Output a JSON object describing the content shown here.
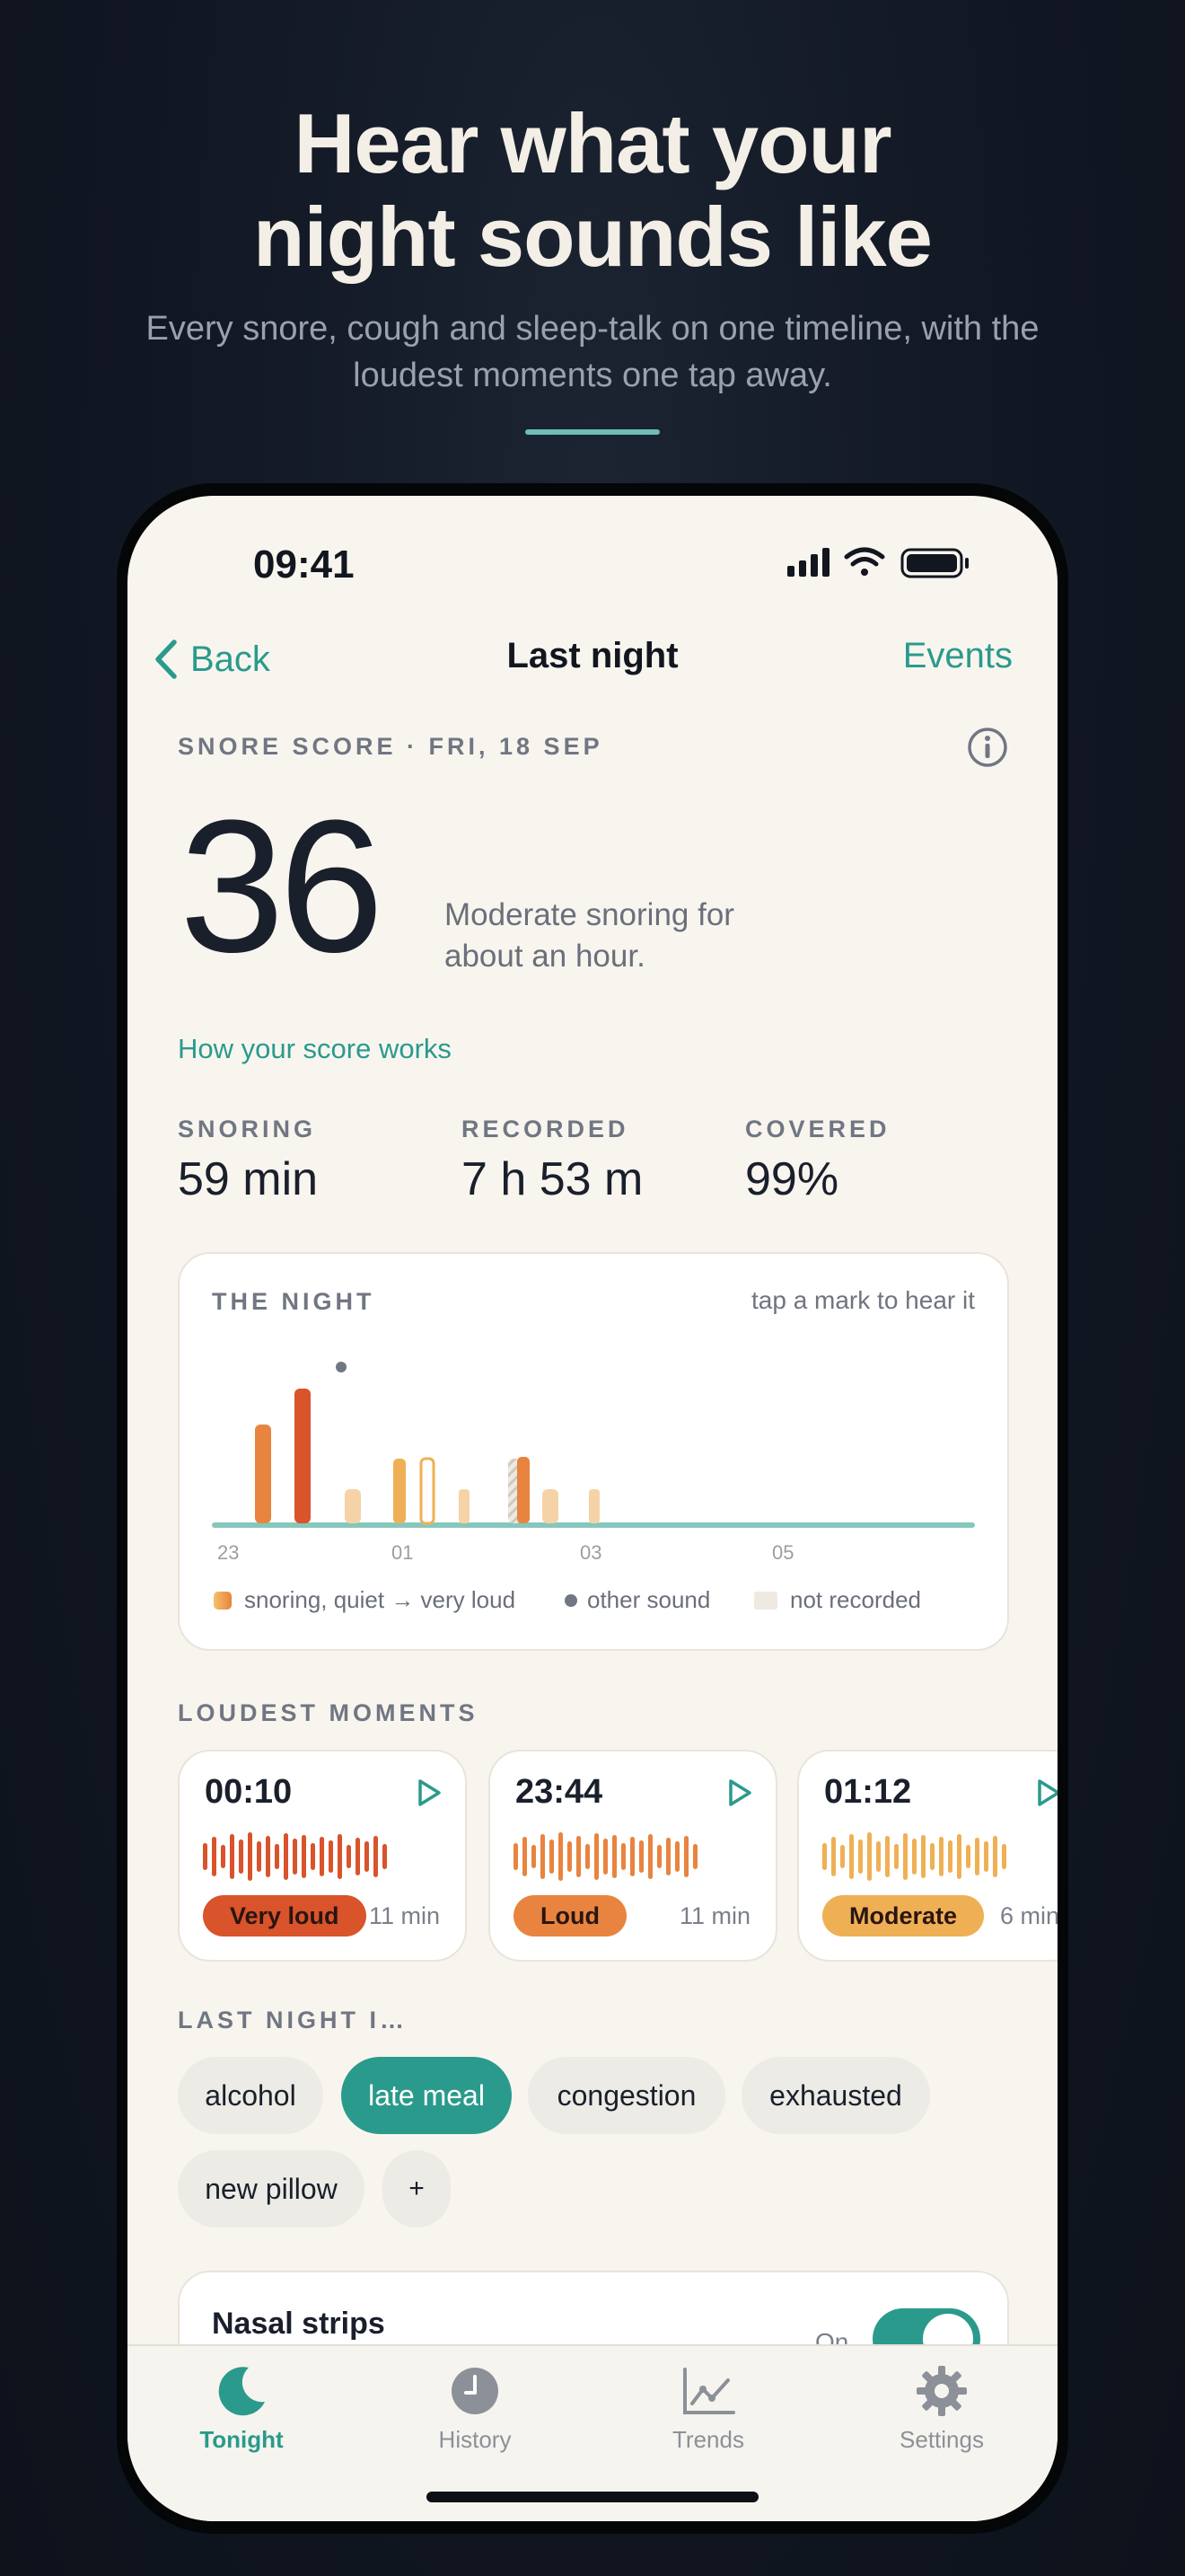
{
  "promo": {
    "title_line1": "Hear what your",
    "title_line2": "night sounds like",
    "subtitle": "Every snore, cough and sleep-talk on one timeline, with the loudest moments one tap away."
  },
  "status_bar": {
    "time": "09:41"
  },
  "nav": {
    "back_label": "Back",
    "title": "Last night",
    "right_label": "Events"
  },
  "score": {
    "eyebrow": "SNORE SCORE · FRI, 18 SEP",
    "value": "36",
    "description": "Moderate snoring for about an hour.",
    "link": "How your score works"
  },
  "stats": [
    {
      "label": "SNORING",
      "value": "59 min"
    },
    {
      "label": "RECORDED",
      "value": "7 h 53 m"
    },
    {
      "label": "COVERED",
      "value": "99%"
    }
  ],
  "night": {
    "title": "THE NIGHT",
    "hint": "tap a mark to hear it",
    "axis_ticks": [
      "23",
      "01",
      "03",
      "05"
    ],
    "legend": {
      "snoring": "snoring, quiet → very loud",
      "other": "other sound",
      "not_recorded": "not recorded"
    },
    "colors": {
      "very_loud": "#d9532b",
      "loud": "#e8843f",
      "moderate": "#efb055",
      "quiet": "#f5d3a6",
      "baseline": "#86c7bd"
    }
  },
  "loudest": {
    "title": "LOUDEST MOMENTS",
    "items": [
      {
        "time": "00:10",
        "badge": "Very loud",
        "duration": "11 min",
        "color": "#d9532b"
      },
      {
        "time": "23:44",
        "badge": "Loud",
        "duration": "11 min",
        "color": "#e8843f"
      },
      {
        "time": "01:12",
        "badge": "Moderate",
        "duration": "6 min",
        "color": "#efb055"
      }
    ]
  },
  "tags": {
    "title": "LAST NIGHT I…",
    "chips": [
      "alcohol",
      "late meal",
      "congestion",
      "exhausted",
      "new pillow",
      "+"
    ],
    "active": "late meal"
  },
  "remedy": {
    "label": "Nasal strips",
    "state": "On"
  },
  "tabs": [
    {
      "label": "Tonight",
      "icon": "moon-icon"
    },
    {
      "label": "History",
      "icon": "clock-icon"
    },
    {
      "label": "Trends",
      "icon": "chart-icon"
    },
    {
      "label": "Settings",
      "icon": "gear-icon"
    }
  ]
}
